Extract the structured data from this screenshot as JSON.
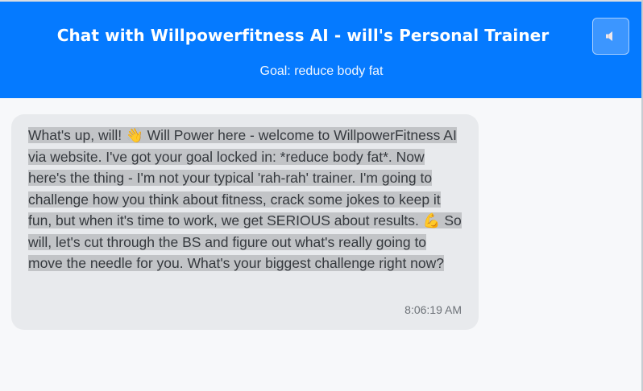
{
  "header": {
    "title": "Chat with Willpowerfitness AI - will's Personal Trainer",
    "subtitle": "Goal: reduce body fat",
    "sound_button_icon": "speaker-icon",
    "accent_color": "#057aff"
  },
  "chat": {
    "messages": [
      {
        "sender": "assistant",
        "text": "What's up, will! 👋 Will Power here - welcome to WillpowerFitness AI via website. I've got your goal locked in: *reduce body fat*. Now here's the thing - I'm not your typical 'rah-rah' trainer. I'm going to challenge how you think about fitness, crack some jokes to keep it fun, but when it's time to work, we get SERIOUS about results. 💪 So will, let's cut through the BS and figure out what's really going to move the needle for you. What's your biggest challenge right now?",
        "time": "8:06:19 AM"
      }
    ]
  }
}
